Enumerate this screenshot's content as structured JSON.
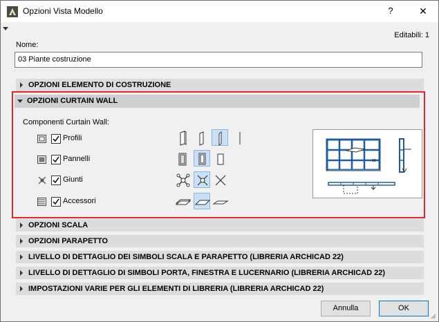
{
  "window": {
    "title": "Opzioni Vista Modello",
    "help": "?",
    "close": "✕"
  },
  "editable": "Editabili: 1",
  "name": {
    "label": "Nome:",
    "value": "03 Piante costruzione"
  },
  "sections": {
    "construction": "OPZIONI ELEMENTO DI COSTRUZIONE",
    "curtain_wall": "OPZIONI CURTAIN WALL",
    "stair": "OPZIONI SCALA",
    "railing": "OPZIONI PARAPETTO",
    "detail_stair": "LIVELLO DI DETTAGLIO DEI SIMBOLI SCALA E PARAPETTO (LIBRERIA ARCHICAD 22)",
    "detail_door": "LIVELLO DI DETTAGLIO DI SIMBOLI PORTA, FINESTRA E LUCERNARIO (LIBRERIA ARCHICAD 22)",
    "misc": "IMPOSTAZIONI VARIE PER GLI ELEMENTI DI LIBRERIA (LIBRERIA ARCHICAD 22)"
  },
  "curtain_wall": {
    "components_label": "Componenti Curtain Wall:",
    "rows": [
      {
        "label": "Profili",
        "checked": true
      },
      {
        "label": "Pannelli",
        "checked": true
      },
      {
        "label": "Giunti",
        "checked": true
      },
      {
        "label": "Accessori",
        "checked": true
      }
    ]
  },
  "buttons": {
    "cancel": "Annulla",
    "ok": "OK"
  },
  "colors": {
    "accent_border": "#e0282a",
    "selection": "#c9e0f7",
    "frame_blue": "#1f5aa6"
  }
}
